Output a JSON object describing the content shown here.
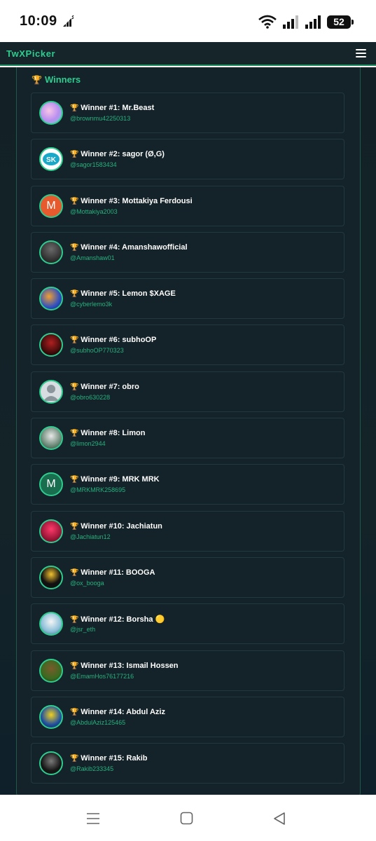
{
  "status_bar": {
    "time": "10:09",
    "battery": "52"
  },
  "app": {
    "brand": "TwXPicker"
  },
  "section": {
    "title": "Winners"
  },
  "colors": {
    "accent": "#2ecc8f",
    "background": "#132126"
  },
  "winners": [
    {
      "name": "Winner #1: Mr.Beast",
      "handle": "@brownmu42250313",
      "avatar": "image"
    },
    {
      "name": "Winner #2: sagor (Ø,G)",
      "handle": "@sagor1583434",
      "avatar": "image"
    },
    {
      "name": "Winner #3: Mottakiya Ferdousi",
      "handle": "@Mottakiya2003",
      "avatar": "letter",
      "letter": "M"
    },
    {
      "name": "Winner #4: Amanshawofficial",
      "handle": "@Amanshaw01",
      "avatar": "image"
    },
    {
      "name": "Winner #5: Lemon $XAGE",
      "handle": "@cyberlemo3k",
      "avatar": "image"
    },
    {
      "name": "Winner #6: subhoOP",
      "handle": "@subhoOP770323",
      "avatar": "image"
    },
    {
      "name": "Winner #7: obro",
      "handle": "@obro630228",
      "avatar": "default"
    },
    {
      "name": "Winner #8: Limon",
      "handle": "@limon2944",
      "avatar": "image"
    },
    {
      "name": "Winner #9: MRK MRK",
      "handle": "@MRKMRK258695",
      "avatar": "letter",
      "letter": "M"
    },
    {
      "name": "Winner #10: Jachiatun",
      "handle": "@Jachiatun12",
      "avatar": "image"
    },
    {
      "name": "Winner #11: BOOGA",
      "handle": "@ox_booga",
      "avatar": "image"
    },
    {
      "name": "Winner #12: Borsha 🟡",
      "handle": "@jsr_eth",
      "avatar": "image"
    },
    {
      "name": "Winner #13: Ismail Hossen",
      "handle": "@EmamHos76177216",
      "avatar": "image"
    },
    {
      "name": "Winner #14: Abdul Aziz",
      "handle": "@AbdulAziz125465",
      "avatar": "image"
    },
    {
      "name": "Winner #15: Rakib",
      "handle": "@Rakib233345",
      "avatar": "image"
    }
  ]
}
